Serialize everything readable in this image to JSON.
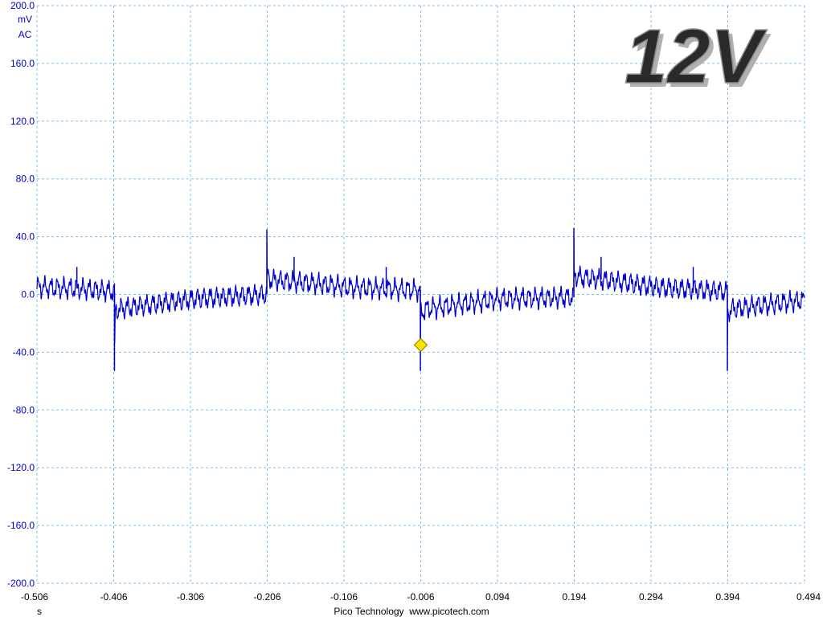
{
  "chart_data": {
    "type": "line",
    "ylim": [
      -200,
      200
    ],
    "xlim": [
      -0.506,
      0.494
    ],
    "y_ticks": [
      "200.0",
      "160.0",
      "120.0",
      "80.0",
      "40.0",
      "0.0",
      "-40.0",
      "-80.0",
      "-120.0",
      "-160.0",
      "-200.0"
    ],
    "x_ticks": [
      "-0.506",
      "-0.406",
      "-0.306",
      "-0.206",
      "-0.106",
      "-0.006",
      "0.094",
      "0.194",
      "0.294",
      "0.394",
      "0.494"
    ],
    "y_unit": "mV",
    "coupling": "AC",
    "x_unit": "s",
    "grid": true,
    "trigger_marker": {
      "x": -0.006,
      "y": -35
    },
    "series": [
      {
        "color": "#0000cc",
        "x": [
          -0.506,
          -0.45,
          -0.405,
          -0.405,
          -0.404,
          -0.4,
          -0.3,
          -0.2065,
          -0.2065,
          -0.206,
          -0.2,
          -0.15,
          -0.1,
          -0.0065,
          -0.0065,
          -0.006,
          0.0,
          0.1,
          0.1935,
          0.1935,
          0.194,
          0.2,
          0.25,
          0.3,
          0.3935,
          0.3935,
          0.394,
          0.4,
          0.494
        ],
        "y": [
          5,
          4,
          2,
          -53,
          -12,
          -10,
          -3,
          0,
          45,
          12,
          10,
          8,
          5,
          3,
          -53,
          -14,
          -10,
          -3,
          -2,
          46,
          14,
          12,
          9,
          5,
          2,
          -53,
          -12,
          -10,
          -4
        ]
      }
    ],
    "spikes": [
      {
        "x": -0.454,
        "y": 19
      },
      {
        "x": -0.171,
        "y": 26
      },
      {
        "x": -0.051,
        "y": 19
      },
      {
        "x": 0.229,
        "y": 26
      },
      {
        "x": 0.349,
        "y": 19
      }
    ]
  },
  "watermark": "12V",
  "footer": "Pico Technology  www.picotech.com",
  "colors": {
    "grid": "#7fc0e8",
    "axis_text": "#0000d0",
    "trace": "#0000cc",
    "marker_fill": "#f5e400",
    "marker_stroke": "#8a7a00"
  }
}
